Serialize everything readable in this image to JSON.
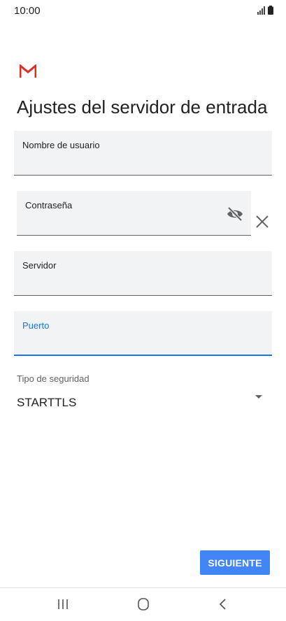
{
  "status_bar": {
    "time": "10:00",
    "icons": [
      "signal-icon",
      "battery-icon"
    ]
  },
  "app": {
    "logo": "gmail-logo-icon",
    "title": "Ajustes del servidor de entrada"
  },
  "form": {
    "username": {
      "label": "Nombre de usuario",
      "value": ""
    },
    "password": {
      "label": "Contraseña",
      "value": "",
      "toggle_icon": "eye-off-icon",
      "clear_icon": "close-icon"
    },
    "server": {
      "label": "Servidor",
      "value": ""
    },
    "port": {
      "label": "Puerto",
      "value": "",
      "focused": true
    },
    "security": {
      "label": "Tipo de seguridad",
      "value": "STARTTLS"
    }
  },
  "actions": {
    "next_label": "SIGUIENTE"
  },
  "nav": {
    "items": [
      "recents-icon",
      "home-icon",
      "back-icon"
    ]
  },
  "colors": {
    "accent": "#1a73e8",
    "button": "#4285f4",
    "field_bg": "#f1f3f4",
    "gmail_red": "#d93025"
  }
}
